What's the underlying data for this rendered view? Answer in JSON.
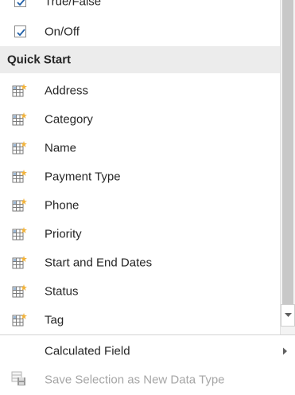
{
  "menu": {
    "checkbox_items": [
      {
        "label": "True/False",
        "checked": true
      },
      {
        "label": "On/Off",
        "checked": true
      }
    ],
    "group_header": "Quick Start",
    "quick_start_items": [
      {
        "label": "Address"
      },
      {
        "label": "Category"
      },
      {
        "label": "Name"
      },
      {
        "label": "Payment Type"
      },
      {
        "label": "Phone"
      },
      {
        "label": "Priority"
      },
      {
        "label": "Start and End Dates"
      },
      {
        "label": "Status"
      },
      {
        "label": "Tag"
      }
    ],
    "footer": {
      "calculated_field": "Calculated Field",
      "save_selection": "Save Selection as New Data Type"
    },
    "icons": {
      "checkbox": "checkbox-checked-icon",
      "quick_start": "table-field-icon",
      "submenu": "chevron-right-icon",
      "save": "save-data-type-icon",
      "scroll_down": "chevron-down-icon"
    },
    "colors": {
      "check": "#1f5fa8",
      "header_bg": "#ececec",
      "disabled_text": "#a6a6a6"
    }
  }
}
